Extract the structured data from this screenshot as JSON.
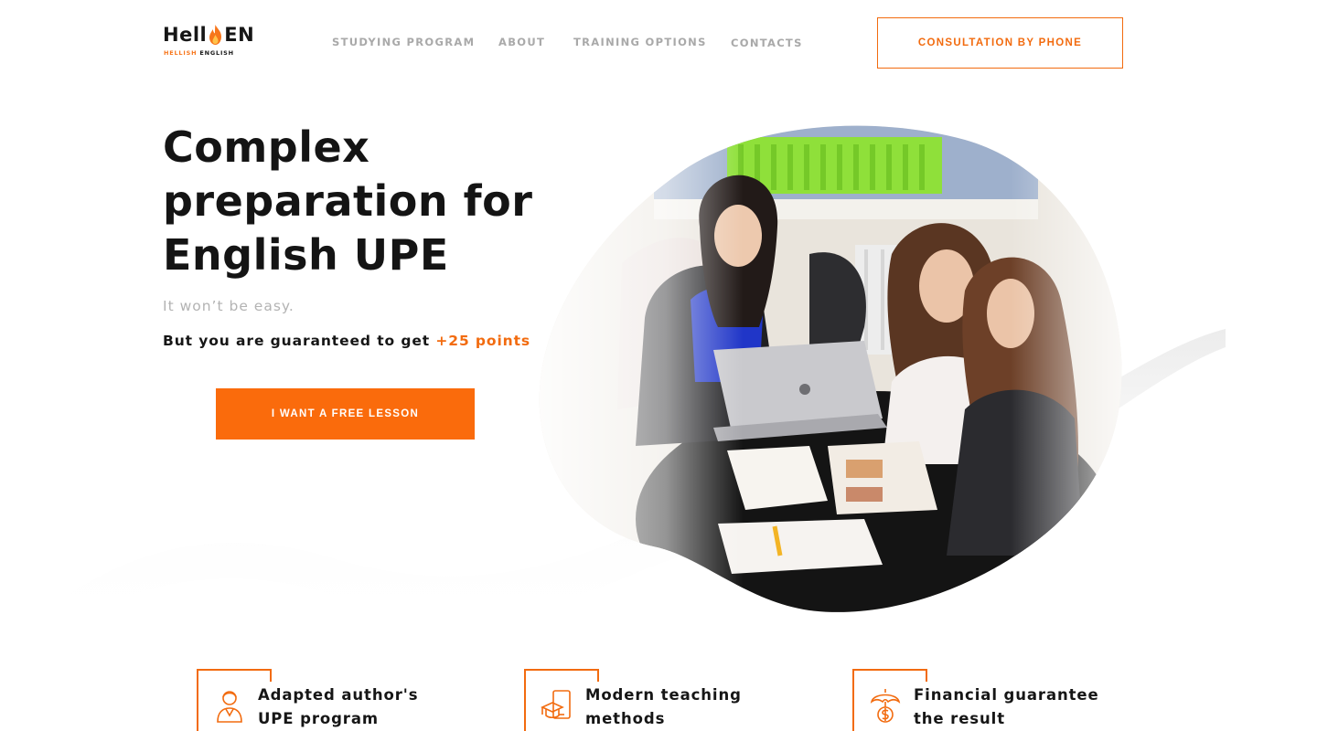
{
  "logo": {
    "main_left": "Hell",
    "main_right": "EN",
    "sub_accent": "HELLISH",
    "sub_rest": "ENGLISH"
  },
  "nav": {
    "items": [
      {
        "label": "STUDYING PROGRAM"
      },
      {
        "label": "ABOUT"
      },
      {
        "label": "TRAINING OPTIONS"
      },
      {
        "label": "CONTACTS"
      }
    ]
  },
  "header": {
    "cta_label": "CONSULTATION BY PHONE"
  },
  "hero": {
    "title_line1": "Complex",
    "title_line2": "preparation for",
    "title_line3": "English UPE",
    "subtitle": "It won’t be easy.",
    "guarantee_prefix": "But you are guaranteed to get",
    "guarantee_accent": "+25 points",
    "cta_label": "I WANT A FREE LESSON"
  },
  "features": [
    {
      "line1": "Adapted author's",
      "line2": "UPE program",
      "icon": "teacher-icon"
    },
    {
      "line1": "Modern teaching",
      "line2": "methods",
      "icon": "graduation-laptop-icon"
    },
    {
      "line1": "Financial guarantee",
      "line2": "the result",
      "icon": "umbrella-money-icon"
    }
  ],
  "colors": {
    "accent": "#f26b0f",
    "button": "#fa6b0c",
    "text": "#161616",
    "muted": "#a9a9a9"
  }
}
